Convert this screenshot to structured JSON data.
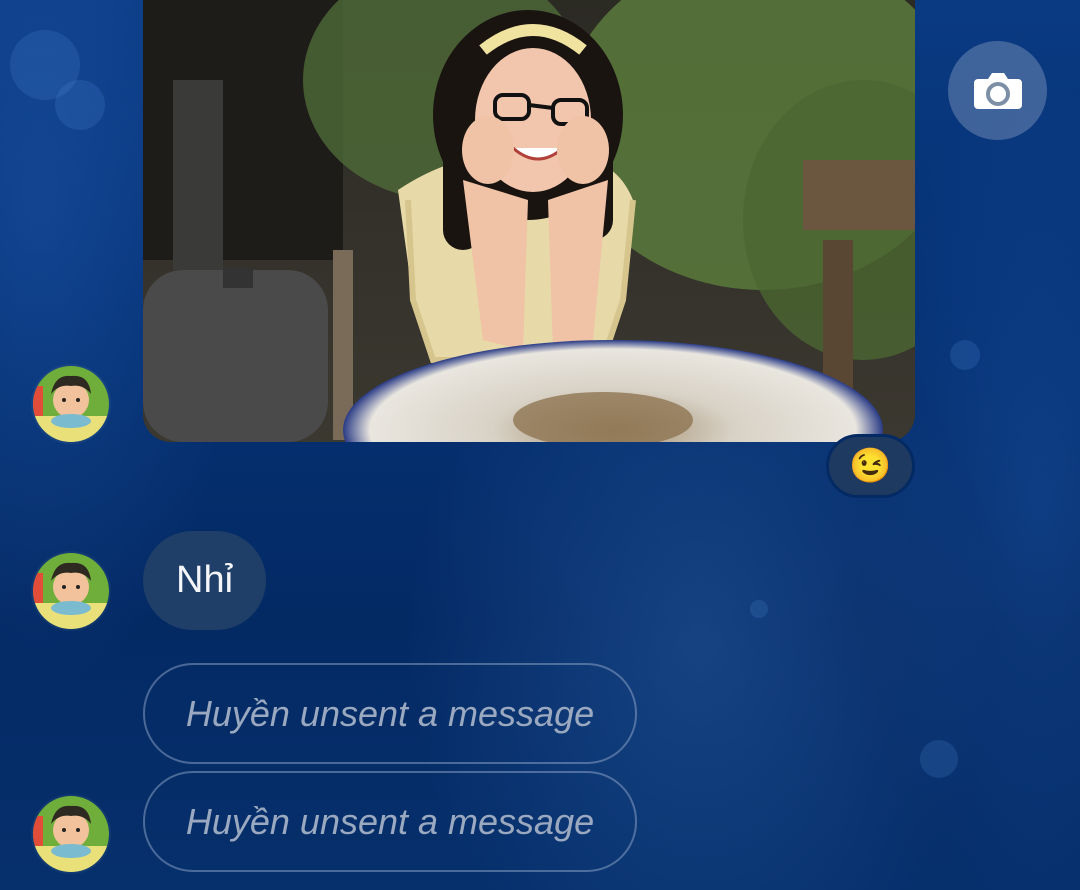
{
  "conversation": {
    "messages": [
      {
        "type": "photo",
        "sender": "Huyền",
        "reaction": "😉"
      },
      {
        "type": "text",
        "sender": "Huyền",
        "text": "Nhỉ"
      },
      {
        "type": "unsent",
        "sender": "Huyền",
        "text": "Huyền unsent a message"
      },
      {
        "type": "unsent",
        "sender": "Huyền",
        "text": "Huyền unsent a message"
      }
    ]
  },
  "actions": {
    "camera_icon": "camera-icon"
  },
  "colors": {
    "background": "#042a64",
    "bubble": "#1f3f68",
    "unsent_border": "#8a9bb5",
    "unsent_text": "#9aa9c0"
  }
}
